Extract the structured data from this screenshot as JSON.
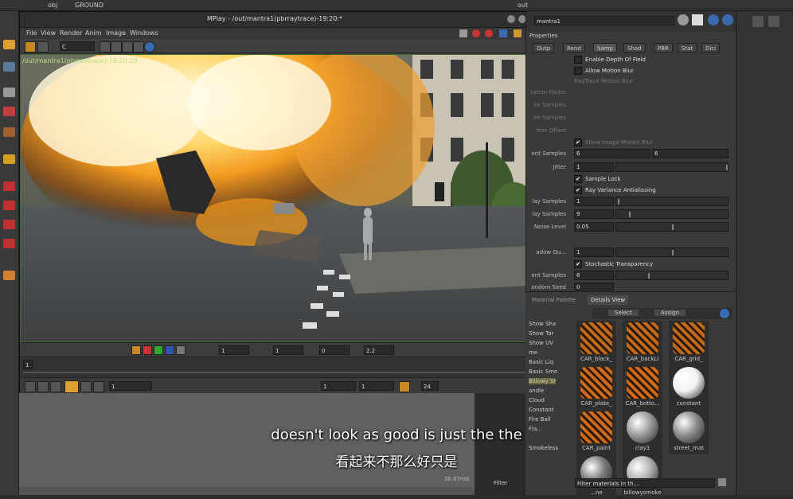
{
  "top": {
    "path_obj": "obj",
    "path_ground": "GROUND",
    "path_out": "out"
  },
  "mplay": {
    "title": "MPlay - /out/mantra1(pbrraytrace)-19:20:*",
    "menu": [
      "File",
      "View",
      "Render",
      "Anim",
      "Image",
      "Windows"
    ],
    "toolbar_channel": "C",
    "viewport_label": "/out/mantra1(pbrraytrace)-19:20:20",
    "ctrl_fields": [
      "1",
      "1",
      "0",
      "2.2"
    ],
    "timeline_frame": "1",
    "play_fields": [
      "1",
      "1",
      "1",
      "24"
    ]
  },
  "props": {
    "node_name": "mantra1",
    "section": "Properties",
    "tabs": [
      "Outp",
      "Rend",
      "Samp",
      "Shad",
      "PBR",
      "Stat",
      "Dici"
    ],
    "checkboxes": {
      "enable_dof": "Enable Depth Of Field",
      "allow_motion_blur": "Allow Motion Blur",
      "raytrace_motion_blur": "RayTrace Motion Blur",
      "allow_image_motion_blur": "Allow Image Motion Blur",
      "sample_lock": "Sample Lock",
      "ray_variance_aa": "Ray Variance Antialiasing",
      "stochastic_transparency": "Stochastic Transparency"
    },
    "labels": {
      "ration_factor": "ration Factor",
      "ire_samples": "ire Samples",
      "ire_samples2": "ire Samples",
      "itter_offset": "itter Offset",
      "ent_samples": "ent Samples",
      "jitter": "Jitter",
      "lay_samples": "lay Samples",
      "lay_samples2": "lay Samples",
      "noise_level": "Noise Level",
      "shadow_qu": "adow Qu...",
      "ent_samples2": "ent Samples",
      "andom_seed": "andom Seed"
    },
    "values": {
      "pixel_samples_x": "6",
      "pixel_samples_y": "6",
      "jitter": "1",
      "min_ray_samples": "1",
      "max_ray_samples": "9",
      "noise_level": "0.05",
      "shadow_quality": "1",
      "transparent_samples": "6",
      "random_seed": "0"
    }
  },
  "materials": {
    "tabs": [
      "Material Palette",
      "Details View"
    ],
    "select_label": "Select",
    "assign_label": "Assign",
    "left_list": [
      "Show Sha",
      "Show Tar",
      "Show UV",
      "me",
      "Basic Liq",
      "Basic Smo",
      "Billowy Sr",
      "andle",
      "Cloud",
      "Constant",
      "Fire Ball",
      "Fla...",
      "Smokeless"
    ],
    "tiles": [
      {
        "name": "CAR_black_",
        "color": "#c26a1a"
      },
      {
        "name": "CAR_backLi",
        "color": "#c26a1a"
      },
      {
        "name": "CAR_grid_",
        "color": "#c26a1a"
      },
      {
        "name": "CAR_plate_",
        "color": "#d06a18"
      },
      {
        "name": "CAR_botto...",
        "color": "#d06a18"
      },
      {
        "name": "constant",
        "color": "#f2f2f2"
      },
      {
        "name": "CAR_paint",
        "color": "#d06a18"
      },
      {
        "name": "clay1",
        "color": "#9a9a9a"
      },
      {
        "name": "street_mat",
        "color": "#8a8a8a"
      },
      {
        "name": "...ne",
        "color": "#7a7a7a"
      },
      {
        "name": "billowysmoke",
        "color": "#b0b0b0"
      }
    ],
    "filter_label": "Filter",
    "filter_placeholder": "Filter materials in th..."
  },
  "subtitles": {
    "en": "doesn't look as good is just the the",
    "zh": "看起来不那么好只是"
  },
  "net": {
    "mem": "30.07mb"
  }
}
